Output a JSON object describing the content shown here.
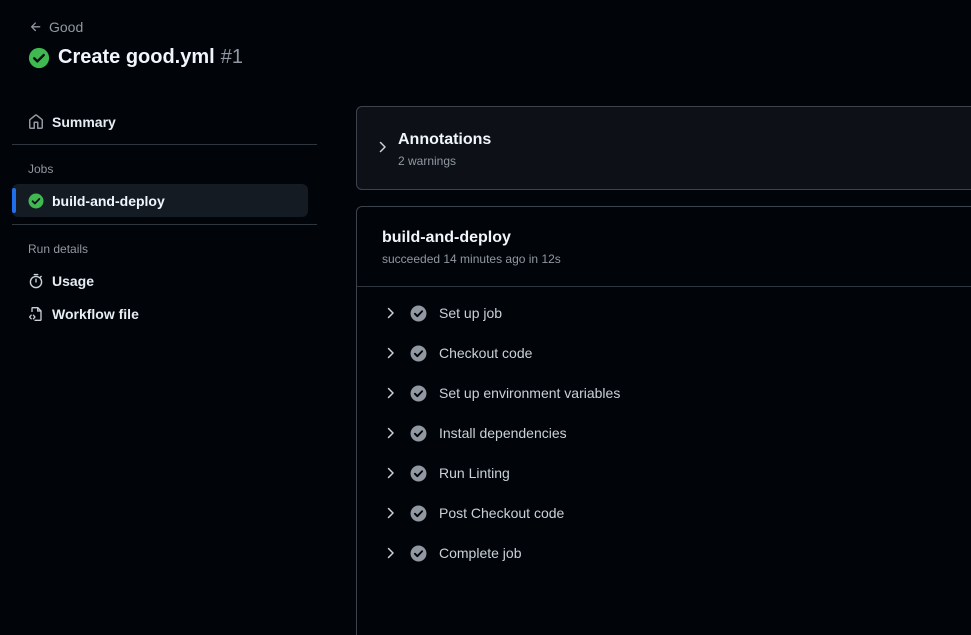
{
  "header": {
    "back_label": "Good",
    "title": "Create good.yml",
    "run_number": "#1"
  },
  "sidebar": {
    "summary_label": "Summary",
    "jobs_heading": "Jobs",
    "jobs": [
      {
        "label": "build-and-deploy",
        "status": "success",
        "active": true
      }
    ],
    "run_details_heading": "Run details",
    "run_details": [
      {
        "label": "Usage",
        "icon": "stopwatch-icon"
      },
      {
        "label": "Workflow file",
        "icon": "file-code-icon"
      }
    ]
  },
  "annotations": {
    "title": "Annotations",
    "subtitle": "2 warnings"
  },
  "job": {
    "name": "build-and-deploy",
    "status_text": "succeeded 14 minutes ago in 12s",
    "steps": [
      {
        "label": "Set up job"
      },
      {
        "label": "Checkout code"
      },
      {
        "label": "Set up environment variables"
      },
      {
        "label": "Install dependencies"
      },
      {
        "label": "Run Linting"
      },
      {
        "label": "Post Checkout code"
      },
      {
        "label": "Complete job"
      }
    ]
  },
  "colors": {
    "background": "#010409",
    "success": "#3fb950",
    "step_check": "#9198a1",
    "active_bar": "#1f6feb",
    "muted_text": "#9198a1"
  }
}
